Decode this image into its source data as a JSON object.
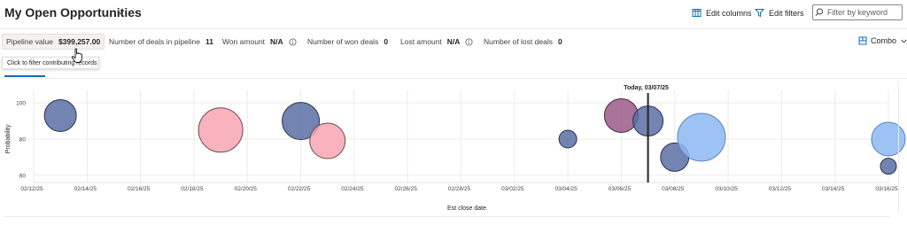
{
  "header": {
    "title": "My Open Opportunities",
    "edit_columns": "Edit columns",
    "edit_filters": "Edit filters",
    "search_placeholder": "Filter by keyword"
  },
  "metrics": [
    {
      "label": "Pipeline value",
      "value": "$399,257.00"
    },
    {
      "label": "Number of deals in pipeline",
      "value": "11"
    },
    {
      "label": "Won amount",
      "value": "N/A"
    },
    {
      "label": "Number of won deals",
      "value": "0"
    },
    {
      "label": "Lost amount",
      "value": "N/A"
    },
    {
      "label": "Number of lost deals",
      "value": "0"
    }
  ],
  "tooltip": "Click to filter contributing records",
  "view_selector": "Combo",
  "colors": {
    "accent": "#0f6cbd",
    "navy": "#5b6fa6",
    "pink": "#f7a6b4",
    "purple": "#9a5a8a",
    "light_blue": "#8cb8f2"
  },
  "chart_data": {
    "type": "scatter",
    "xlabel": "Est close date",
    "ylabel": "Probability",
    "x_ticks": [
      "02/12/25",
      "02/14/25",
      "02/16/25",
      "02/18/25",
      "02/20/25",
      "02/22/25",
      "02/24/25",
      "02/26/25",
      "02/28/25",
      "03/02/25",
      "03/04/25",
      "03/06/25",
      "03/08/25",
      "03/10/25",
      "03/12/25",
      "03/14/25",
      "03/16/25"
    ],
    "y_ticks": [
      "60",
      "80",
      "100"
    ],
    "ylim": [
      56,
      104
    ],
    "xlim": [
      "02/12/2025",
      "03/16/2025"
    ],
    "today_label": "Today, 03/07/25",
    "today_date": "03/07/2025",
    "grid": true,
    "points": [
      {
        "x": "02/13/2025",
        "y": 93,
        "size": 36,
        "color": "#5b6fa6"
      },
      {
        "x": "02/19/2025",
        "y": 85,
        "size": 50,
        "color": "#f7a6b4"
      },
      {
        "x": "02/22/2025",
        "y": 90,
        "size": 42,
        "color": "#5b6fa6"
      },
      {
        "x": "02/23/2025",
        "y": 79,
        "size": 40,
        "color": "#f7a6b4"
      },
      {
        "x": "03/04/2025",
        "y": 80,
        "size": 20,
        "color": "#5b6fa6"
      },
      {
        "x": "03/06/2025",
        "y": 93,
        "size": 38,
        "color": "#9a5a8a"
      },
      {
        "x": "03/07/2025",
        "y": 90,
        "size": 34,
        "color": "#5b6fa6"
      },
      {
        "x": "03/08/2025",
        "y": 70,
        "size": 32,
        "color": "#5b6fa6"
      },
      {
        "x": "03/09/2025",
        "y": 81,
        "size": 54,
        "color": "#8cb8f2"
      },
      {
        "x": "03/16/2025",
        "y": 80,
        "size": 38,
        "color": "#8cb8f2"
      },
      {
        "x": "03/16/2025",
        "y": 65,
        "size": 18,
        "color": "#5b6fa6"
      }
    ]
  }
}
